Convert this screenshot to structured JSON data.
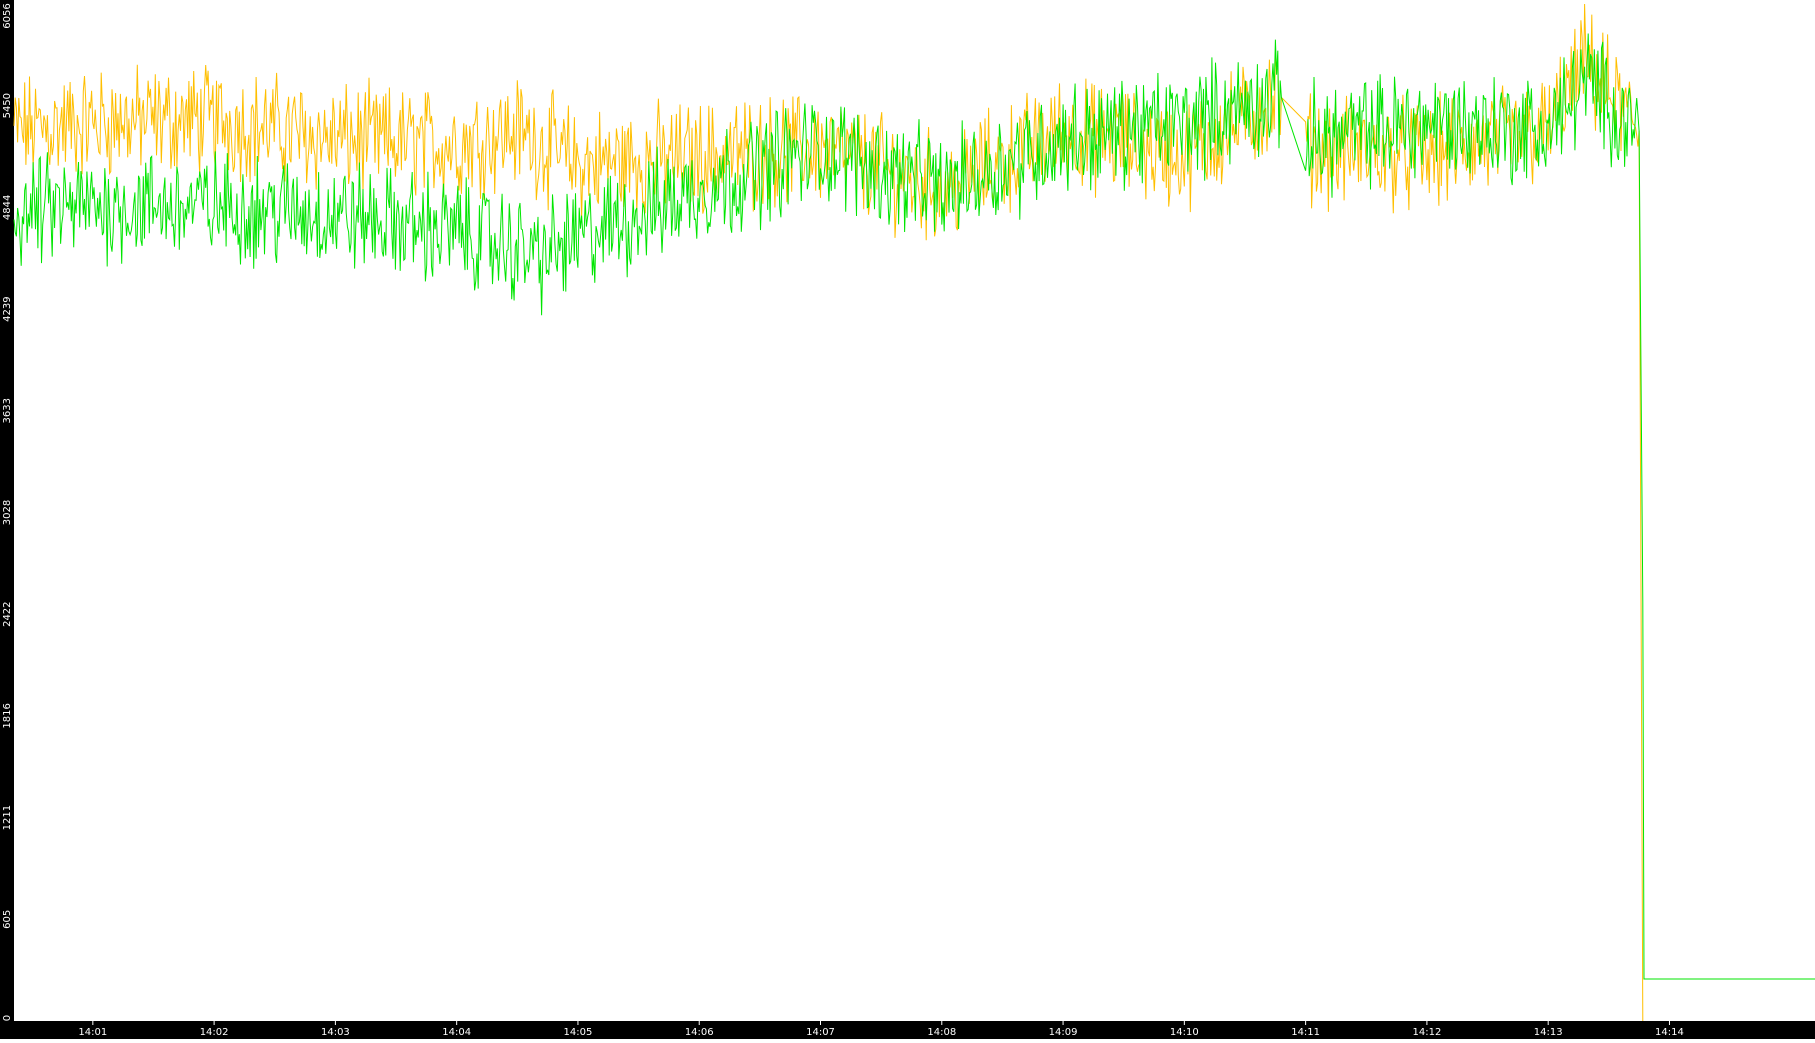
{
  "chart_data": {
    "type": "line",
    "title": "",
    "xlabel": "",
    "ylabel": "",
    "ylim": [
      0,
      6056
    ],
    "y_ticks": [
      "0",
      "605",
      "1211",
      "1816",
      "2422",
      "3028",
      "3633",
      "4239",
      "4844",
      "5450",
      "6056"
    ],
    "x_ticks": [
      "14:01",
      "14:02",
      "14:03",
      "14:04",
      "14:05",
      "14:06",
      "14:07",
      "14:08",
      "14:09",
      "14:10",
      "14:11",
      "14:12",
      "14:13",
      "14:14"
    ],
    "x_range_minutes": [
      0.35,
      15.2
    ],
    "x_tick_minutes": [
      1,
      2,
      3,
      4,
      5,
      6,
      7,
      8,
      9,
      10,
      11,
      12,
      13,
      14
    ],
    "grid": false,
    "legend": "none",
    "background": "#ffffff",
    "axis_background": "#000000",
    "series": [
      {
        "color": "#ffbf00",
        "x": [
          0.35,
          1.0,
          2.0,
          3.0,
          4.0,
          4.5,
          5.0,
          6.0,
          7.0,
          8.0,
          9.0,
          10.0,
          10.8,
          11.0,
          12.0,
          13.0,
          13.3,
          13.75,
          13.78
        ],
        "values": [
          5300,
          5350,
          5370,
          5250,
          5220,
          5300,
          5100,
          5150,
          5200,
          4950,
          5300,
          5150,
          5500,
          5200,
          5150,
          5300,
          5700,
          5300,
          0
        ]
      },
      {
        "color": "#00e600",
        "x": [
          0.35,
          1.0,
          2.0,
          3.0,
          4.0,
          4.7,
          5.0,
          6.0,
          7.0,
          8.0,
          9.0,
          10.0,
          10.8,
          11.0,
          12.0,
          13.0,
          13.3,
          13.75,
          13.78,
          13.79,
          15.2
        ],
        "values": [
          4800,
          4850,
          4850,
          4800,
          4700,
          4550,
          4650,
          4950,
          5200,
          4950,
          5250,
          5350,
          5500,
          5250,
          5350,
          5300,
          5600,
          5300,
          2500,
          250,
          250
        ]
      }
    ]
  }
}
